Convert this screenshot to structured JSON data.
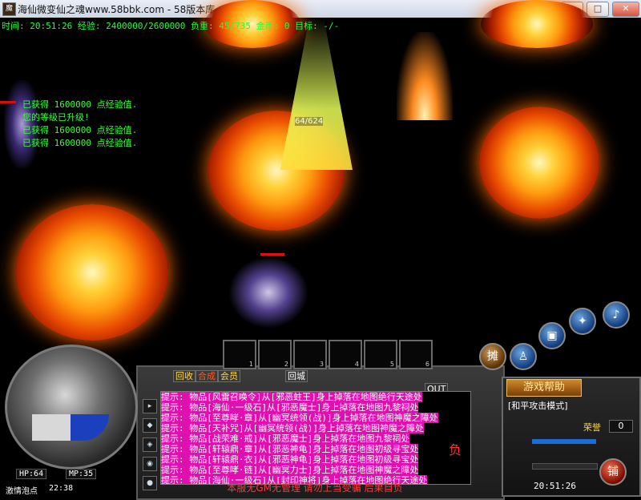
{
  "window": {
    "title": "海仙微变仙之魂www.58bbk.com - 58版本库",
    "icon_text": "魔"
  },
  "hud": {
    "line": "时间: 20:51:26 经验: 2400000/2600000 负重: 45/735 金币: 0 目标: -/-"
  },
  "messages": [
    "已获得 1600000 点经验值.",
    "您的等级已升级!",
    "已获得 1600000 点经验值.",
    "已获得 1600000 点经验值."
  ],
  "player_hp": "64/624",
  "stats": {
    "hp": "HP:64",
    "mp": "MP:35",
    "level_label": "激情泡点",
    "level_time": "22:38"
  },
  "slots": [
    "1",
    "2",
    "3",
    "4",
    "5",
    "6"
  ],
  "tabs": {
    "recover": "回收",
    "compose": "合成",
    "member": "会员",
    "recycle2": "回城",
    "out": "OUT"
  },
  "chat": [
    "提示: 物品[风雷召唤令]从[邪恶蛀王]身上掉落在地图绝行天途处",
    "提示: 物品[海仙·一级石]从[邪恶魔士]身上掉落在地图九黎祠处",
    "提示: 物品[至尊哮·章]从[幽冥统领(战)]身上掉落在地图神魔之障处",
    "提示: 物品[天补咒]从[幽冥统领(战)]身上掉落在地图神魔之障处",
    "提示: 物品[战荣难·戒]从[邪恶魔士]身上掉落在地图九黎祠处",
    "提示: 物品[轩辕鼎·章]从[邪恶神龟]身上掉落在地图初级寻宝处",
    "提示: 物品[轩辕鼎·衣]从[邪恶神龟]身上掉落在地图初级寻宝处",
    "提示: 物品[至尊哮·链]从[幽冥力士]身上掉落在地图神魔之障处",
    "提示: 物品[海仙·一级石]从[封印神将]身上掉落在地图绝行天途处"
  ],
  "chat_footer": "本服无GM无管理 请勿上当受骗 后果自负",
  "chat_side": "负",
  "right": {
    "help": "游戏帮助",
    "mode": "[和平攻击模式]",
    "honor_label": "荣誉",
    "honor_value": "0",
    "time": "20:51:26",
    "shop": "铺",
    "trade": "摊"
  }
}
